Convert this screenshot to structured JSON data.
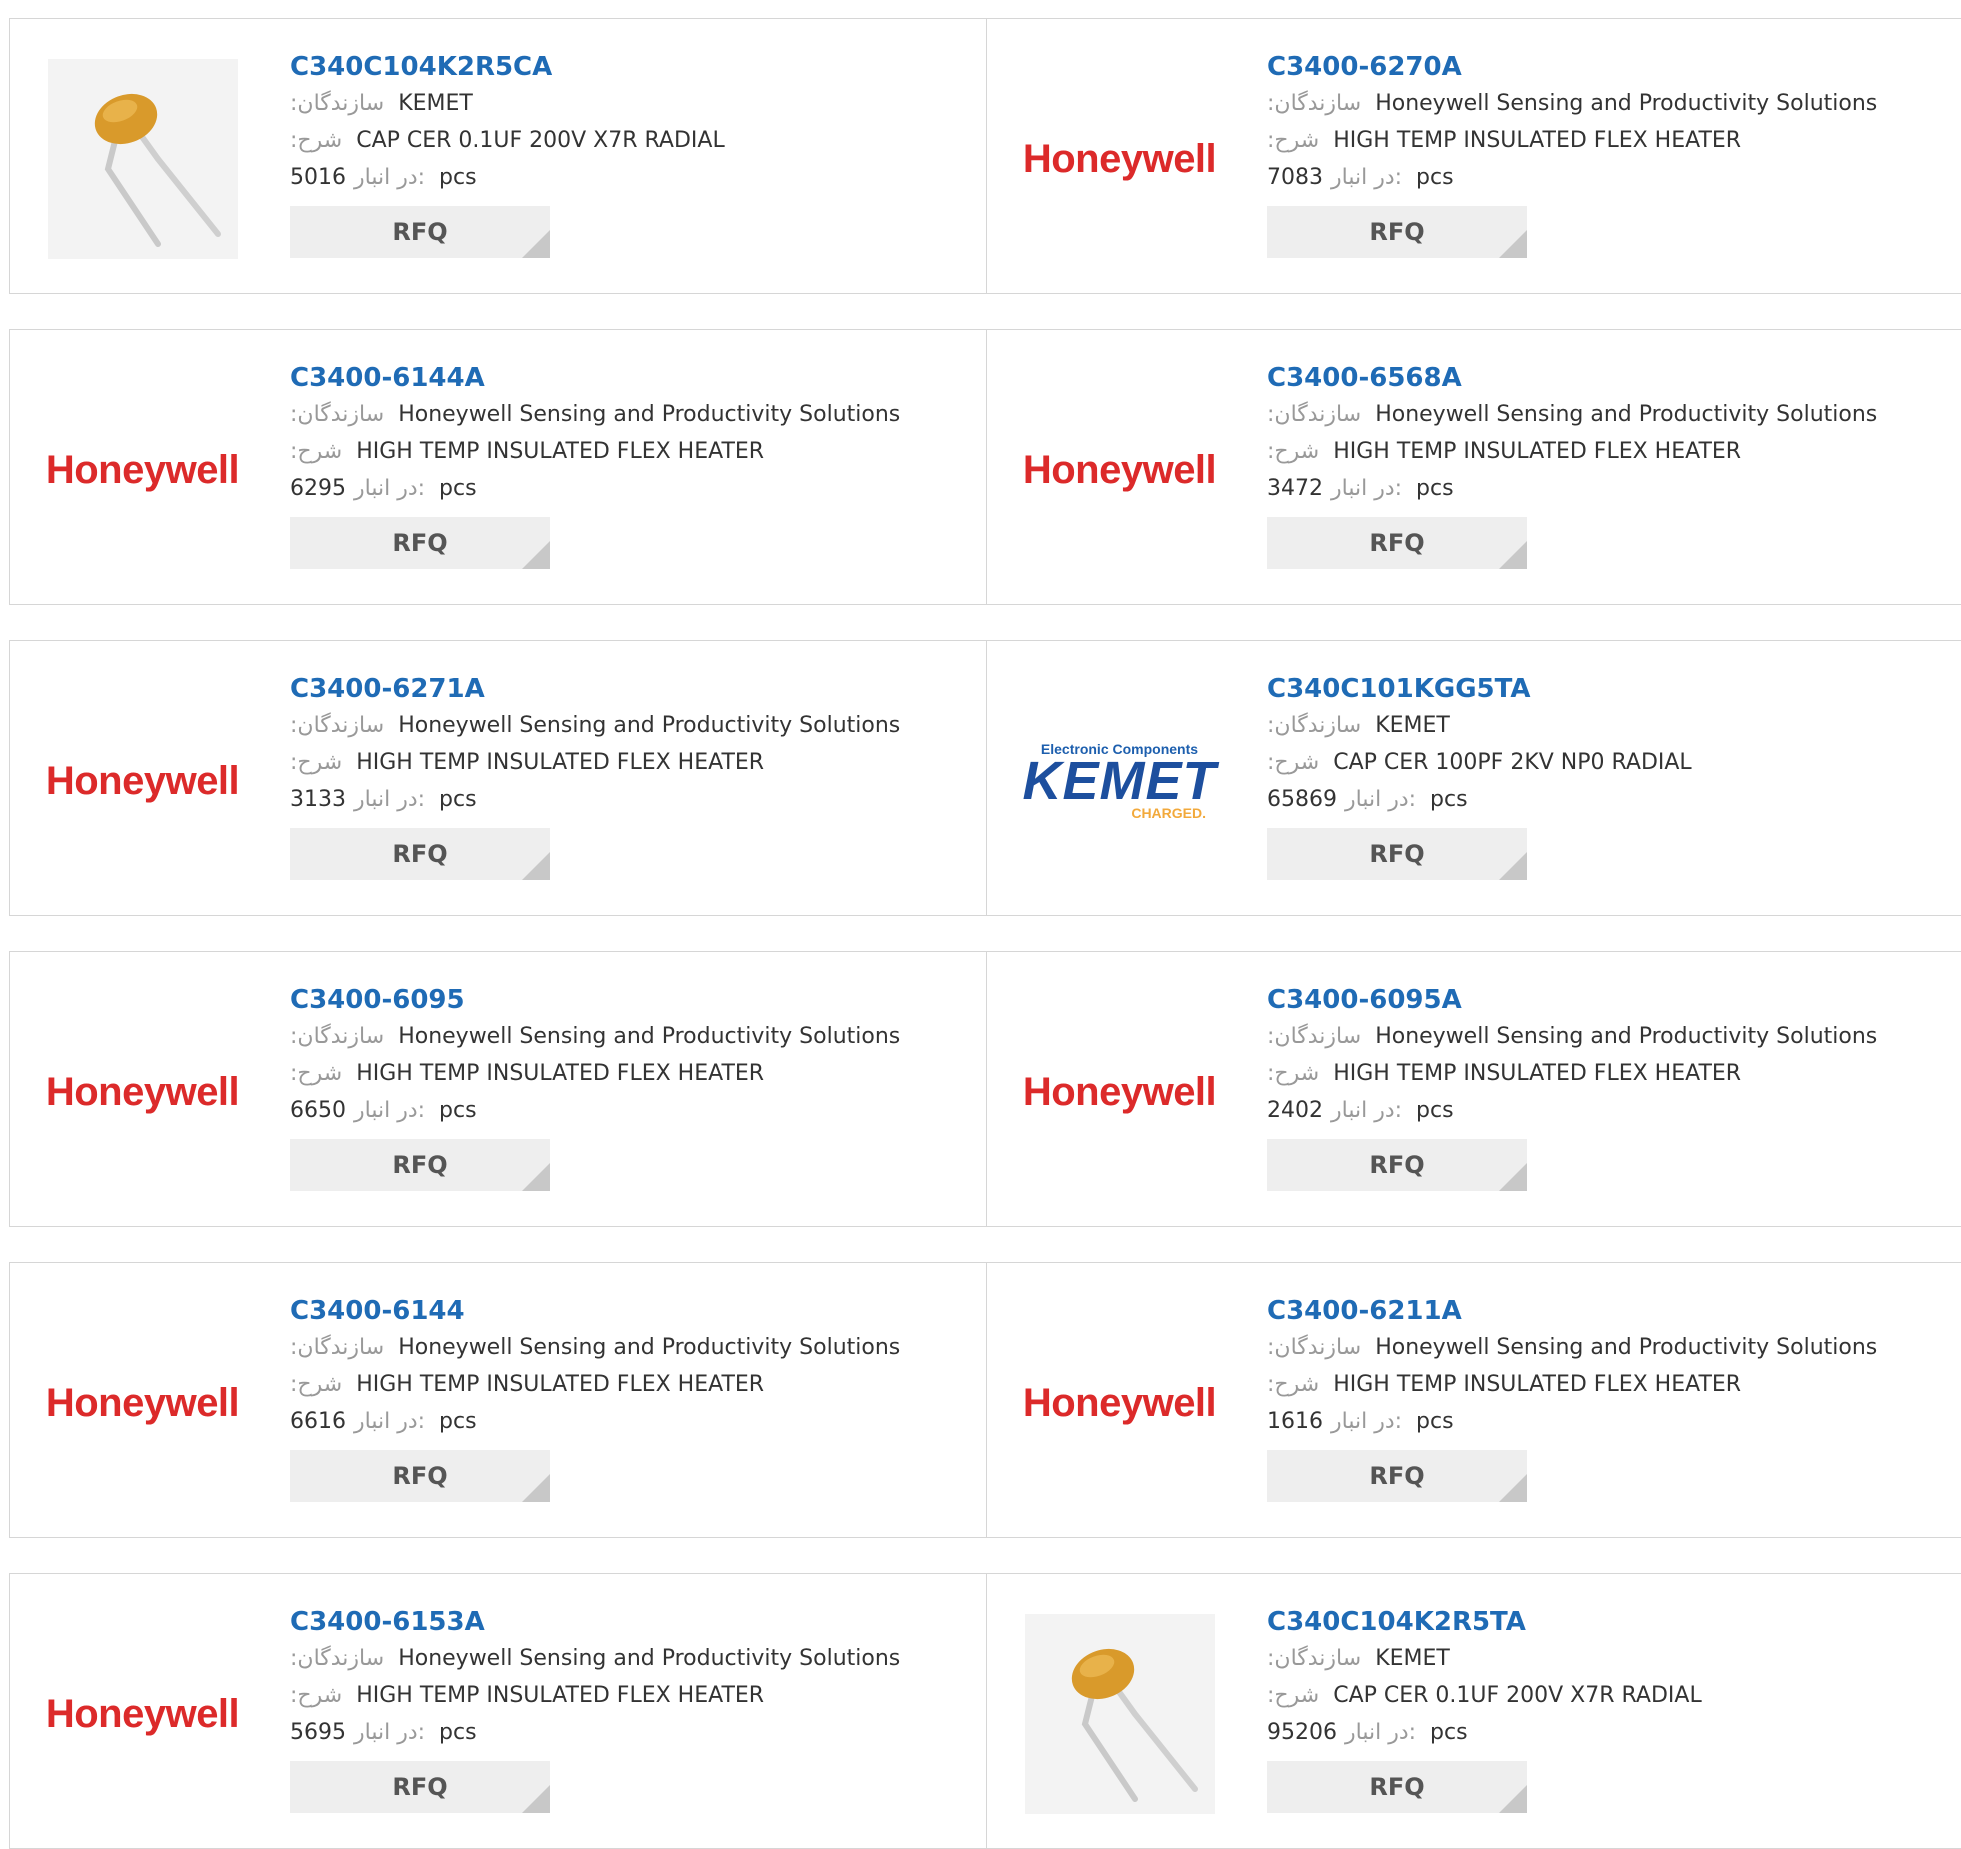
{
  "labels": {
    "manufacturer": ":سازندگان",
    "description": ":شرح",
    "stock": "در انبار:",
    "unit": "pcs",
    "rfq": "RFQ"
  },
  "products": [
    {
      "part": "C340C104K2R5CA",
      "manufacturer": "KEMET",
      "description": "CAP CER 0.1UF 200V X7R RADIAL",
      "stock": "5016",
      "image": "capacitor-photo"
    },
    {
      "part": "C3400-6270A",
      "manufacturer": "Honeywell Sensing and Productivity Solutions",
      "description": "HIGH TEMP INSULATED FLEX HEATER",
      "stock": "7083",
      "image": "honeywell-logo",
      "logo_text": "Honeywell"
    },
    {
      "part": "C3400-6144A",
      "manufacturer": "Honeywell Sensing and Productivity Solutions",
      "description": "HIGH TEMP INSULATED FLEX HEATER",
      "stock": "6295",
      "image": "honeywell-logo",
      "logo_text": "Honeywell"
    },
    {
      "part": "C3400-6568A",
      "manufacturer": "Honeywell Sensing and Productivity Solutions",
      "description": "HIGH TEMP INSULATED FLEX HEATER",
      "stock": "3472",
      "image": "honeywell-logo",
      "logo_text": "Honeywell"
    },
    {
      "part": "C3400-6271A",
      "manufacturer": "Honeywell Sensing and Productivity Solutions",
      "description": "HIGH TEMP INSULATED FLEX HEATER",
      "stock": "3133",
      "image": "honeywell-logo",
      "logo_text": "Honeywell"
    },
    {
      "part": "C340C101KGG5TA",
      "manufacturer": "KEMET",
      "description": "CAP CER 100PF 2KV NP0 RADIAL",
      "stock": "65869",
      "image": "kemet-logo",
      "logo_lines": [
        "Electronic Components",
        "KEMET",
        "CHARGED."
      ]
    },
    {
      "part": "C3400-6095",
      "manufacturer": "Honeywell Sensing and Productivity Solutions",
      "description": "HIGH TEMP INSULATED FLEX HEATER",
      "stock": "6650",
      "image": "honeywell-logo",
      "logo_text": "Honeywell"
    },
    {
      "part": "C3400-6095A",
      "manufacturer": "Honeywell Sensing and Productivity Solutions",
      "description": "HIGH TEMP INSULATED FLEX HEATER",
      "stock": "2402",
      "image": "honeywell-logo",
      "logo_text": "Honeywell"
    },
    {
      "part": "C3400-6144",
      "manufacturer": "Honeywell Sensing and Productivity Solutions",
      "description": "HIGH TEMP INSULATED FLEX HEATER",
      "stock": "6616",
      "image": "honeywell-logo",
      "logo_text": "Honeywell"
    },
    {
      "part": "C3400-6211A",
      "manufacturer": "Honeywell Sensing and Productivity Solutions",
      "description": "HIGH TEMP INSULATED FLEX HEATER",
      "stock": "1616",
      "image": "honeywell-logo",
      "logo_text": "Honeywell"
    },
    {
      "part": "C3400-6153A",
      "manufacturer": "Honeywell Sensing and Productivity Solutions",
      "description": "HIGH TEMP INSULATED FLEX HEATER",
      "stock": "5695",
      "image": "honeywell-logo",
      "logo_text": "Honeywell"
    },
    {
      "part": "C340C104K2R5TA",
      "manufacturer": "KEMET",
      "description": "CAP CER 0.1UF 200V X7R RADIAL",
      "stock": "95206",
      "image": "capacitor-photo"
    }
  ]
}
